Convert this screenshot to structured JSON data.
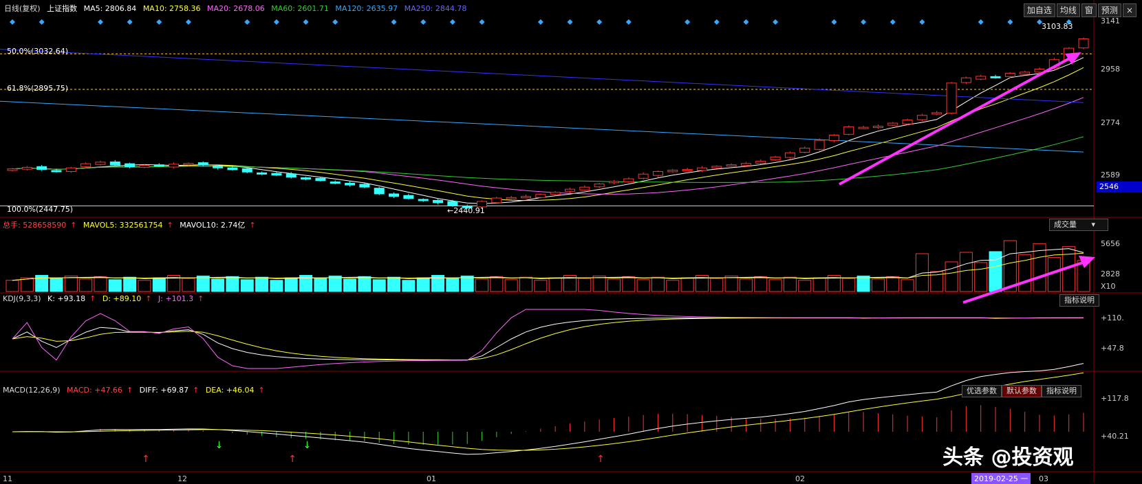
{
  "header": {
    "period": "日线(复权)",
    "symbol": "上证指数",
    "ma": [
      {
        "label": "MA5: 2806.84",
        "color": "#ffffff"
      },
      {
        "label": "MA10: 2758.36",
        "color": "#ffff33"
      },
      {
        "label": "MA20: 2678.06",
        "color": "#ff66ff"
      },
      {
        "label": "MA60: 2601.71",
        "color": "#33cc33"
      },
      {
        "label": "MA120: 2635.97",
        "color": "#33aaff"
      },
      {
        "label": "MA250: 2844.78",
        "color": "#3333ff"
      }
    ],
    "buttons": [
      "加自选",
      "均线",
      "窗",
      "预测"
    ],
    "close_icon": "×"
  },
  "price_panel": {
    "fib_levels": [
      {
        "label": "50.0%(3032.64)"
      },
      {
        "label": "61.8%(2895.75)"
      },
      {
        "label": "100.0%(2447.75)"
      }
    ],
    "high_marker": "3103.83",
    "low_marker": "←2440.91",
    "y_ticks": [
      "3141",
      "2958",
      "2774",
      "2589"
    ],
    "price_badge": "2546",
    "colors": {
      "up": "#ff3333",
      "down": "#33ffff",
      "fib": "#ffcc33",
      "arrow": "#ff33ff"
    }
  },
  "volume_panel": {
    "total": "总手: 528658590",
    "mavol5": "MAVOL5: 332561754",
    "mavol10": "MAVOL10: 2.74亿",
    "selector": "成交量",
    "y_ticks": [
      "5656",
      "2828"
    ],
    "unit": "X10"
  },
  "kdj_panel": {
    "title": "KDJ(9,3,3)",
    "k": "K: +93.18",
    "d": "D: +89.10",
    "j": "J: +101.3",
    "button": "指标说明",
    "y_ticks": [
      "+110.",
      "+47.8"
    ]
  },
  "macd_panel": {
    "title": "MACD(12,26,9)",
    "macd": "MACD: +47.66",
    "diff": "DIFF: +69.87",
    "dea": "DEA: +46.04",
    "buttons": [
      "优选参数",
      "默认参数",
      "指标说明"
    ],
    "y_ticks": [
      "+117.8",
      "+40.21"
    ]
  },
  "x_axis": {
    "labels": [
      "11",
      "12",
      "01",
      "02",
      "03"
    ],
    "highlight_date": "2019-02-25 一"
  },
  "watermark": "头条 @投资观",
  "chart_data": {
    "type": "candlestick",
    "title": "上证指数",
    "series": [
      {
        "name": "close",
        "values": [
          2590,
          2596,
          2588,
          2580,
          2594,
          2610,
          2616,
          2605,
          2598,
          2604,
          2602,
          2608,
          2611,
          2605,
          2594,
          2587,
          2578,
          2572,
          2566,
          2558,
          2552,
          2545,
          2536,
          2528,
          2520,
          2494,
          2484,
          2476,
          2468,
          2460,
          2448,
          2442,
          2465,
          2478,
          2480,
          2484,
          2492,
          2500,
          2512,
          2520,
          2532,
          2542,
          2552,
          2570,
          2580,
          2585,
          2588,
          2594,
          2600,
          2606,
          2611,
          2620,
          2636,
          2652,
          2670,
          2700,
          2720,
          2752,
          2750,
          2754,
          2766,
          2778,
          2796,
          2806,
          2920,
          2940,
          2946,
          2942,
          2958,
          2962,
          2974,
          3010,
          3054,
          3090
        ]
      }
    ],
    "markers": {
      "high": 3103.83,
      "low": 2440.91
    },
    "fibonacci": [
      {
        "pct": "50.0%",
        "value": 3032.64
      },
      {
        "pct": "61.8%",
        "value": 2895.75
      },
      {
        "pct": "100.0%",
        "value": 2447.75
      }
    ],
    "moving_averages": [
      {
        "name": "MA5",
        "value": 2806.84
      },
      {
        "name": "MA10",
        "value": 2758.36
      },
      {
        "name": "MA20",
        "value": 2678.06
      },
      {
        "name": "MA60",
        "value": 2601.71
      },
      {
        "name": "MA120",
        "value": 2635.97
      },
      {
        "name": "MA250",
        "value": 2844.78
      }
    ],
    "volume": {
      "total": 528658590,
      "mavol5": 332561754,
      "mavol10": "2.74亿"
    },
    "kdj": {
      "K": 93.18,
      "D": 89.1,
      "J": 101.3
    },
    "macd": {
      "MACD": 47.66,
      "DIFF": 69.87,
      "DEA": 46.04
    },
    "ylim": [
      2420,
      3160
    ]
  }
}
